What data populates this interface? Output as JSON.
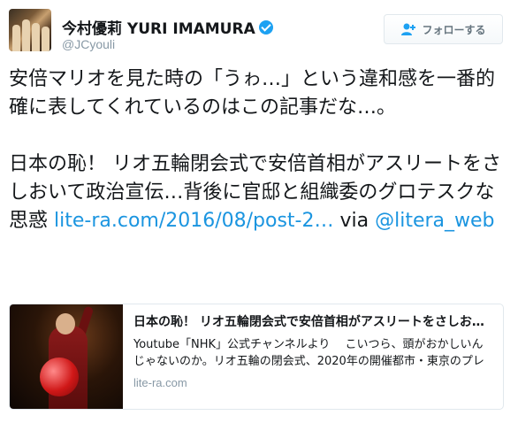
{
  "user": {
    "display_name": "今村優莉 YURI IMAMURA",
    "handle": "@JCyouli",
    "verified": true,
    "avatar_icon": "avatar-photo"
  },
  "follow_button": {
    "label": "フォローする",
    "icon": "add-user-icon"
  },
  "tweet": {
    "paragraph1": "安倍マリオを見た時の「うゎ…」という違和感を一番的確に表してくれているのはこの記事だな…。",
    "paragraph2_text": "日本の恥！ リオ五輪閉会式で安倍首相がアスリートをさしおいて政治宣伝…背後に官邸と組織委のグロテスク",
    "paragraph2_text2": "な思惑 ",
    "link_url": "lite-ra.com/2016/08/post-2…",
    "via_text": " via ",
    "mention": "@litera_web"
  },
  "card": {
    "title": "日本の恥！ リオ五輪閉会式で安倍首相がアスリートをさしおい…",
    "description": "Youtube「NHK」公式チャンネルより　 こいつら、頭がおかしいんじゃないのか。リオ五輪の閉会式、2020年の開催都市・東京のプレゼンテーションで、土管から…",
    "domain": "lite-ra.com"
  },
  "colors": {
    "link": "#1b95e0",
    "verified": "#1da1f2",
    "muted": "#8899a6",
    "text": "#14171a"
  }
}
